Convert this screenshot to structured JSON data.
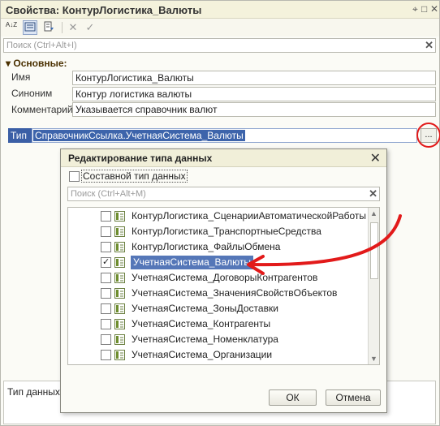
{
  "window": {
    "title": "Свойства: КонтурЛогистика_Валюты",
    "controls": [
      "⌖",
      "□",
      "✕"
    ]
  },
  "toolbar": {
    "sort_label": "A↓Z",
    "search_placeholder": "Поиск (Ctrl+Alt+I)"
  },
  "section": {
    "title": "Основные:"
  },
  "fields": {
    "name_label": "Имя",
    "name_value": "КонтурЛогистика_Валюты",
    "synonym_label": "Синоним",
    "synonym_value": "Контур логистика валюты",
    "comment_label": "Комментарий",
    "comment_value": "Указывается справочник валют",
    "type_label": "Тип",
    "type_value": "СправочникСсылка.УчетнаяСистема_Валюты",
    "type_button": "..."
  },
  "bottom_panel": {
    "label": "Тип данных"
  },
  "dialog": {
    "title": "Редактирование типа данных",
    "close": "✕",
    "composite_label": "Составной тип данных",
    "search_placeholder": "Поиск (Ctrl+Alt+M)",
    "items": [
      {
        "label": "КонтурЛогистика_СценарииАвтоматическойРаботы",
        "checked": false
      },
      {
        "label": "КонтурЛогистика_ТранспортныеСредства",
        "checked": false
      },
      {
        "label": "КонтурЛогистика_ФайлыОбмена",
        "checked": false
      },
      {
        "label": "УчетнаяСистема_Валюты",
        "checked": true
      },
      {
        "label": "УчетнаяСистема_ДоговорыКонтрагентов",
        "checked": false
      },
      {
        "label": "УчетнаяСистема_ЗначенияСвойствОбъектов",
        "checked": false
      },
      {
        "label": "УчетнаяСистема_ЗоныДоставки",
        "checked": false
      },
      {
        "label": "УчетнаяСистема_Контрагенты",
        "checked": false
      },
      {
        "label": "УчетнаяСистема_Номенклатура",
        "checked": false
      },
      {
        "label": "УчетнаяСистема_Организации",
        "checked": false
      }
    ],
    "ok_label": "ОК",
    "cancel_label": "Отмена"
  },
  "colors": {
    "annotation": "#e21a1a",
    "selection": "#5577b8"
  }
}
